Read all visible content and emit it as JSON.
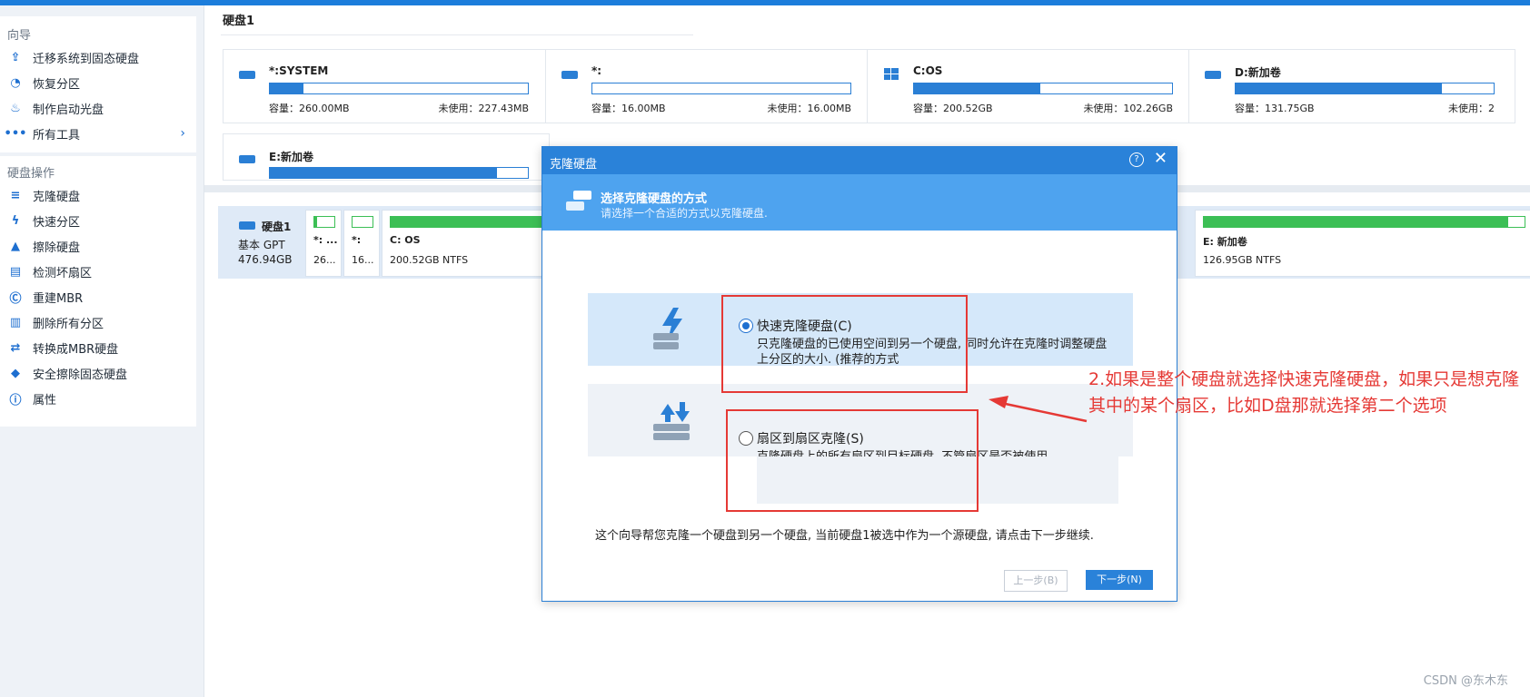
{
  "sidebar": {
    "section1_title": "向导",
    "section1_items": [
      {
        "label": "迁移系统到固态硬盘",
        "icon": "migrate-icon"
      },
      {
        "label": "恢复分区",
        "icon": "recover-partition-icon"
      },
      {
        "label": "制作启动光盘",
        "icon": "bootable-media-icon"
      },
      {
        "label": "所有工具",
        "icon": "more-tools-icon"
      }
    ],
    "section2_title": "硬盘操作",
    "section2_items": [
      {
        "label": "克隆硬盘",
        "icon": "clone-disk-icon"
      },
      {
        "label": "快速分区",
        "icon": "quick-partition-icon"
      },
      {
        "label": "擦除硬盘",
        "icon": "wipe-disk-icon"
      },
      {
        "label": "检测坏扇区",
        "icon": "bad-sector-icon"
      },
      {
        "label": "重建MBR",
        "icon": "rebuild-mbr-icon"
      },
      {
        "label": "删除所有分区",
        "icon": "delete-partitions-icon"
      },
      {
        "label": "转换成MBR硬盘",
        "icon": "convert-mbr-icon"
      },
      {
        "label": "安全擦除固态硬盘",
        "icon": "secure-erase-icon"
      },
      {
        "label": "属性",
        "icon": "info-icon"
      }
    ]
  },
  "main": {
    "disk_title": "硬盘1",
    "partitions": [
      {
        "name": "*:SYSTEM",
        "cap": "容量：260.00MB",
        "free": "未使用：227.43MB",
        "used_fraction": 0.13,
        "icon": "drive-icon"
      },
      {
        "name": "*:",
        "cap": "容量：16.00MB",
        "free": "未使用：16.00MB",
        "used_fraction": 0.0,
        "icon": "drive-icon"
      },
      {
        "name": "C:OS",
        "cap": "容量：200.52GB",
        "free": "未使用：102.26GB",
        "used_fraction": 0.49,
        "icon": "windows-icon"
      },
      {
        "name": "D:新加卷",
        "cap": "容量：131.75GB",
        "free": "未使用：2",
        "used_fraction": 0.8,
        "icon": "drive-icon"
      },
      {
        "name": "E:新加卷",
        "cap": "",
        "free": "",
        "used_fraction": 0.88,
        "icon": "drive-icon"
      }
    ],
    "disk_map": {
      "name": "硬盘1",
      "type": "基本 GPT",
      "size": "476.94GB",
      "segments": [
        {
          "name": "*: ...",
          "info": "26...",
          "used_fraction": 0.15
        },
        {
          "name": "*:",
          "info": "16...",
          "used_fraction": 0.0
        },
        {
          "name": "C: OS",
          "info": "200.52GB NTFS",
          "used_fraction": 0.5
        },
        {
          "name": "E: 新加卷",
          "info": "126.95GB NTFS",
          "used_fraction": 0.95
        }
      ]
    }
  },
  "dialog": {
    "title": "克隆硬盘",
    "help": "?",
    "close": "✕",
    "header_title": "选择克隆硬盘的方式",
    "header_subtitle": "请选择一个合适的方式以克隆硬盘.",
    "option1": {
      "label": "快速克隆硬盘(C)",
      "desc": "只克隆硬盘的已使用空间到另一个硬盘, 同时允许在克隆时调整硬盘上分区的大小. (推荐的方式",
      "selected": true
    },
    "option2": {
      "label": "扇区到扇区克隆(S)",
      "desc": "克隆硬盘上的所有扇区到目标硬盘, 不管扇区是否被使用.",
      "selected": false
    },
    "note": "这个向导帮您克隆一个硬盘到另一个硬盘, 当前硬盘1被选中作为一个源硬盘, 请点击下一步继续.",
    "prev_button": "上一步(B)",
    "next_button": "下一步(N)"
  },
  "annotation": {
    "text": "2.如果是整个硬盘就选择快速克隆硬盘，如果只是想克隆其中的某个扇区，比如D盘那就选择第二个选项"
  },
  "watermark": "CSDN @东木东",
  "colors": {
    "accent": "#2a82d9",
    "annotation": "#e53935",
    "used_bar_green": "#3cbf55"
  }
}
